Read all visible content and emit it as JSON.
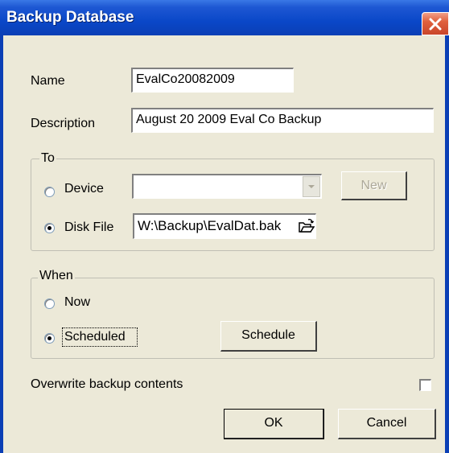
{
  "window": {
    "title": "Backup Database",
    "close_icon": "close-icon"
  },
  "fields": {
    "name_label": "Name",
    "name_value": "EvalCo20082009",
    "description_label": "Description",
    "description_value": "August 20 2009 Eval Co Backup"
  },
  "to_group": {
    "legend": "To",
    "device_label": "Device",
    "device_value": "",
    "new_button": "New",
    "disk_file_label": "Disk File",
    "disk_file_value": "W:\\Backup\\EvalDat.bak",
    "selected": "Disk File"
  },
  "when_group": {
    "legend": "When",
    "now_label": "Now",
    "scheduled_label": "Scheduled",
    "schedule_button": "Schedule",
    "selected": "Scheduled"
  },
  "overwrite": {
    "label": "Overwrite backup contents",
    "checked": false
  },
  "buttons": {
    "ok": "OK",
    "cancel": "Cancel"
  }
}
